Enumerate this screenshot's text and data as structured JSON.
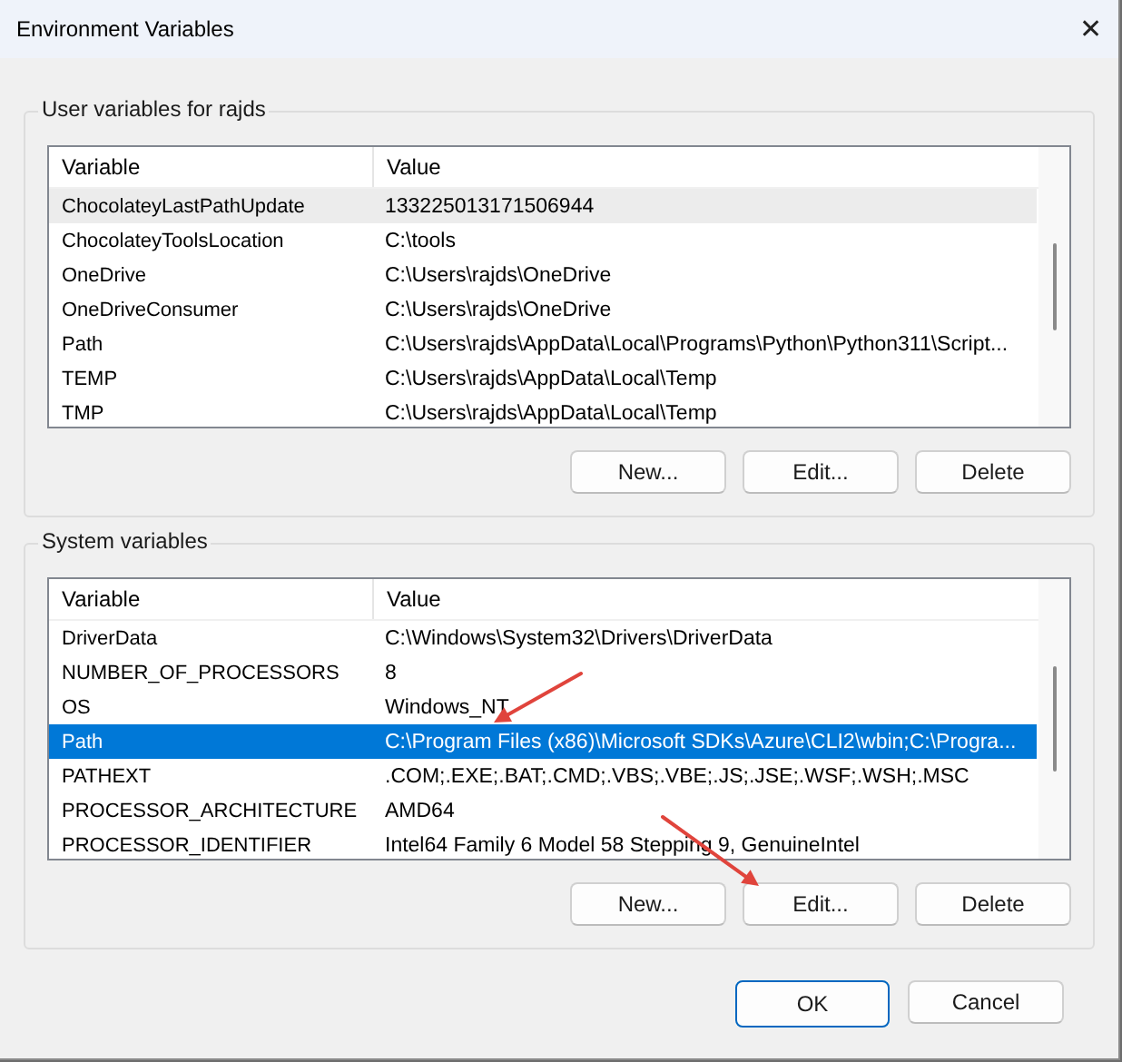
{
  "window": {
    "title": "Environment Variables",
    "close": "✕"
  },
  "groups": [
    {
      "title": "User variables for rajds",
      "columns": [
        "Variable",
        "Value"
      ],
      "rows": [
        {
          "variable": "ChocolateyLastPathUpdate",
          "value": "133225013171506944",
          "selected": false,
          "hovered": true
        },
        {
          "variable": "ChocolateyToolsLocation",
          "value": "C:\\tools",
          "selected": false,
          "hovered": false
        },
        {
          "variable": "OneDrive",
          "value": "C:\\Users\\rajds\\OneDrive",
          "selected": false,
          "hovered": false
        },
        {
          "variable": "OneDriveConsumer",
          "value": "C:\\Users\\rajds\\OneDrive",
          "selected": false,
          "hovered": false
        },
        {
          "variable": "Path",
          "value": "C:\\Users\\rajds\\AppData\\Local\\Programs\\Python\\Python311\\Script...",
          "selected": false,
          "hovered": false
        },
        {
          "variable": "TEMP",
          "value": "C:\\Users\\rajds\\AppData\\Local\\Temp",
          "selected": false,
          "hovered": false
        },
        {
          "variable": "TMP",
          "value": "C:\\Users\\rajds\\AppData\\Local\\Temp",
          "selected": false,
          "hovered": false
        }
      ],
      "buttons": [
        "New...",
        "Edit...",
        "Delete"
      ]
    },
    {
      "title": "System variables",
      "columns": [
        "Variable",
        "Value"
      ],
      "rows": [
        {
          "variable": "DriverData",
          "value": "C:\\Windows\\System32\\Drivers\\DriverData",
          "selected": false,
          "hovered": false
        },
        {
          "variable": "NUMBER_OF_PROCESSORS",
          "value": "8",
          "selected": false,
          "hovered": false
        },
        {
          "variable": "OS",
          "value": "Windows_NT",
          "selected": false,
          "hovered": false
        },
        {
          "variable": "Path",
          "value": "C:\\Program Files (x86)\\Microsoft SDKs\\Azure\\CLI2\\wbin;C:\\Progra...",
          "selected": true,
          "hovered": false
        },
        {
          "variable": "PATHEXT",
          "value": ".COM;.EXE;.BAT;.CMD;.VBS;.VBE;.JS;.JSE;.WSF;.WSH;.MSC",
          "selected": false,
          "hovered": false
        },
        {
          "variable": "PROCESSOR_ARCHITECTURE",
          "value": "AMD64",
          "selected": false,
          "hovered": false
        },
        {
          "variable": "PROCESSOR_IDENTIFIER",
          "value": "Intel64 Family 6 Model 58 Stepping 9, GenuineIntel",
          "selected": false,
          "hovered": false
        }
      ],
      "buttons": [
        "New...",
        "Edit...",
        "Delete"
      ]
    }
  ],
  "dialog_buttons": [
    {
      "label": "OK",
      "default": true
    },
    {
      "label": "Cancel",
      "default": false
    }
  ],
  "annotations": [
    {
      "kind": "arrow"
    },
    {
      "kind": "arrow"
    }
  ]
}
